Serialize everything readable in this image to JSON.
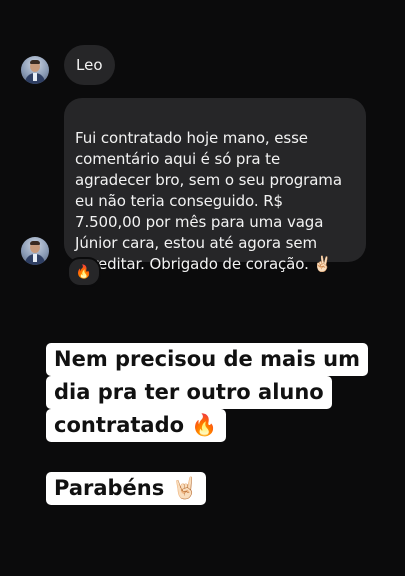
{
  "chat": {
    "sender_name": "Leo",
    "message_text": "Fui contratado hoje mano, esse\ncomentário aqui é só pra te\nagradecer bro, sem o seu programa\neu não teria conseguido. R$\n7.500,00 por mês para uma vaga\nJúnior cara, estou até agora sem\nacreditar. Obrigado de coração. ✌🏻",
    "reaction_emoji": "🔥"
  },
  "caption": {
    "line1": "Nem precisou de mais um",
    "line2": "dia pra ter outro aluno",
    "line3": "contratado 🔥",
    "congrats": "Parabéns 🤘🏻"
  },
  "colors": {
    "background": "#0b0b0c",
    "bubble": "#262628",
    "caption_bg": "#ffffff",
    "caption_text": "#111111"
  },
  "icons": {
    "avatar": "profile-photo-man-in-suit"
  }
}
